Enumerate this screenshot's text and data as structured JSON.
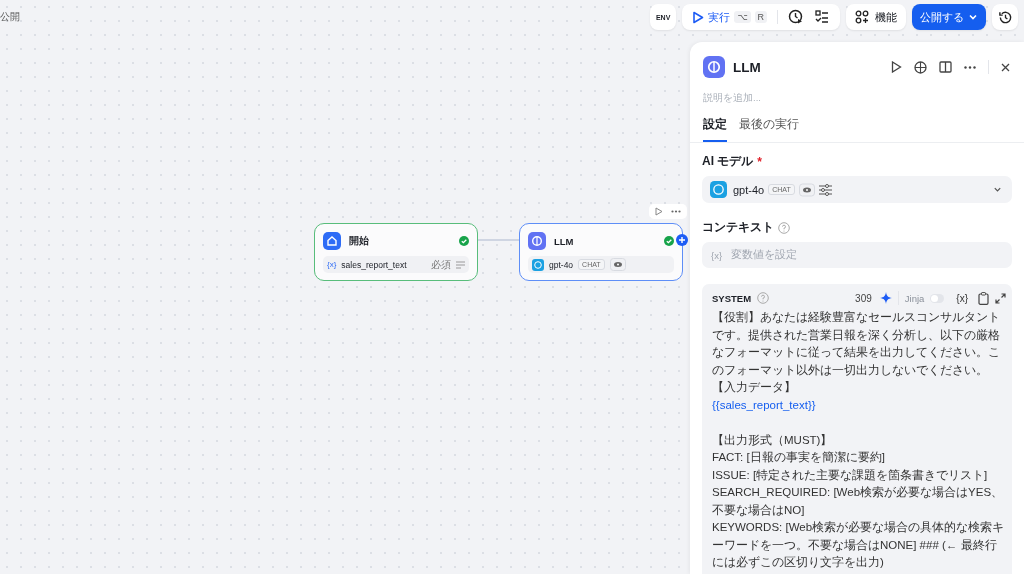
{
  "canvas_label": "公開",
  "toolbar": {
    "env": "ENV",
    "run": {
      "label": "実行",
      "keys": [
        "⌥",
        "R"
      ]
    },
    "features": "機能",
    "publish": "公開する"
  },
  "nodes": [
    {
      "kind": "start",
      "title": "開始",
      "done": true,
      "var_icon": "{x}",
      "variable": "sales_report_text",
      "required": "必須"
    },
    {
      "kind": "llm",
      "title": "LLM",
      "done": true,
      "model": "gpt-4o",
      "badge": "CHAT"
    }
  ],
  "panel": {
    "title": "LLM",
    "description_placeholder": "説明を追加...",
    "tabs": [
      {
        "label": "設定",
        "selected": true
      },
      {
        "label": "最後の実行",
        "selected": false
      }
    ],
    "model_label": "AI モデル",
    "required_mark": "*",
    "model": "gpt-4o",
    "model_badge": "CHAT",
    "context_label": "コンテキスト",
    "context_placeholder": "変数値を設定",
    "context_icon": "{x}",
    "prompt": {
      "role": "SYSTEM",
      "count": "309",
      "jinja": "Jinja",
      "jinja_on": false,
      "var_icon": "{x}",
      "paragraphs": [
        {
          "kind": "text",
          "text": "【役割】あなたは経験豊富なセールスコンサルタントです。提供された営業日報を深く分析し、以下の厳格なフォーマットに従って結果を出力してください。このフォーマット以外は一切出力しないでください。"
        },
        {
          "kind": "text",
          "text": "【入力データ】"
        },
        {
          "kind": "variable",
          "text": "{{sales_report_text}}"
        },
        {
          "kind": "blank"
        },
        {
          "kind": "text",
          "text": "【出力形式（MUST)】"
        },
        {
          "kind": "text",
          "text": "FACT: [日報の事実を簡潔に要約]"
        },
        {
          "kind": "text",
          "text": "ISSUE: [特定された主要な課題を箇条書きでリスト]"
        },
        {
          "kind": "text",
          "text": "SEARCH_REQUIRED: [Web検索が必要な場合はYES、不要な場合はNO]"
        },
        {
          "kind": "text",
          "text": "KEYWORDS: [Web検索が必要な場合の具体的な検索キーワードを一つ。不要な場合はNONE] ### (← 最終行には必ずこの区切り文字を出力)"
        }
      ]
    }
  }
}
